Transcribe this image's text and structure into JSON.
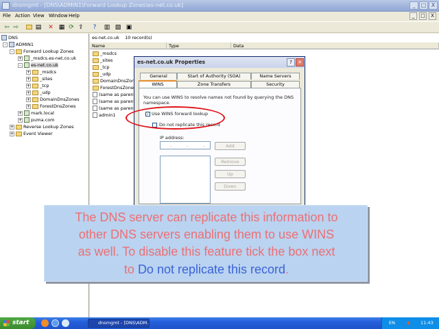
{
  "window": {
    "title": "dnsmgmt - [DNS\\ADMIN1\\Forward Lookup Zones\\es-net.co.uk]",
    "buttons": [
      "_",
      "□",
      "X"
    ]
  },
  "menubar": {
    "items": [
      "File",
      "Action",
      "View",
      "Window",
      "Help"
    ],
    "child_buttons": [
      "_",
      "□",
      "X"
    ]
  },
  "toolbar": {
    "icons": [
      "back-icon",
      "forward-icon",
      "up-folder-icon",
      "show-hide-tree-icon",
      "delete-icon",
      "properties-icon",
      "refresh-icon",
      "export-icon",
      "help-icon",
      "server-icon",
      "zone-icon",
      "record-icon"
    ]
  },
  "tree": {
    "nodes": [
      {
        "label": "DNS",
        "icon": "dns-icon"
      },
      {
        "label": "ADMIN1",
        "icon": "server-icon",
        "pm": "-"
      },
      {
        "label": "Forward Lookup Zones",
        "icon": "folder-icon",
        "pm": "-"
      },
      {
        "label": "_msdcs.es-net.co.uk",
        "icon": "zone-icon",
        "pm": "+"
      },
      {
        "label": "es-net.co.uk",
        "icon": "zone-icon",
        "pm": "-"
      },
      {
        "label": "_msdcs",
        "icon": "folder-icon",
        "pm": "+"
      },
      {
        "label": "_sites",
        "icon": "folder-icon",
        "pm": "+"
      },
      {
        "label": "_tcp",
        "icon": "folder-icon",
        "pm": "+"
      },
      {
        "label": "_udp",
        "icon": "folder-icon",
        "pm": "+"
      },
      {
        "label": "DomainDnsZones",
        "icon": "folder-icon",
        "pm": "+"
      },
      {
        "label": "ForestDnsZones",
        "icon": "folder-icon",
        "pm": "+"
      },
      {
        "label": "mark.local",
        "icon": "zone-icon",
        "pm": "+"
      },
      {
        "label": "puma.com",
        "icon": "zone-icon",
        "pm": "+"
      },
      {
        "label": "Reverse Lookup Zones",
        "icon": "folder-icon",
        "pm": "+"
      },
      {
        "label": "Event Viewer",
        "icon": "folder-icon",
        "pm": "+"
      }
    ]
  },
  "content": {
    "crumb_zone": "es-net.co.uk",
    "crumb_count": "10 record(s)",
    "columns": [
      "Name",
      "Type",
      "Data"
    ],
    "records": [
      "_msdcs",
      "_sites",
      "_tcp",
      "_udp",
      "DomainDnsZones",
      "ForestDnsZones",
      "(same as parent",
      "(same as parent",
      "(same as parent",
      "admin1"
    ]
  },
  "dialog": {
    "title": "es-net.co.uk Properties",
    "tabs_row1": [
      "General",
      "Start of Authority (SOA)",
      "Name Servers"
    ],
    "tabs_row2": [
      "WINS",
      "Zone Transfers",
      "Security"
    ],
    "description_line1": "You can use WINS to resolve names not found by querying the DNS",
    "description_line2": "namespace.",
    "use_wins_label": "Use WINS forward lookup",
    "use_wins_checked": true,
    "no_replicate_label": "Do not replicate this record",
    "no_replicate_checked": false,
    "ip_label": "IP address:",
    "ip_value": ". . .",
    "buttons": {
      "add": "Add",
      "remove": "Remove",
      "up": "Up",
      "down": "Down"
    }
  },
  "caption": {
    "line1": "The DNS server can replicate this information to",
    "line2": "other DNS servers enabling them to use WINS",
    "line3": "as well. To disable this feature tick the box next",
    "line4_pre": "to ",
    "line4_highlight": "Do not replicate this record",
    "line4_post": ".",
    "text_color": "#ec6f74",
    "highlight_color": "#3b63d9",
    "background": "#bad3f0"
  },
  "taskbar": {
    "start": "start",
    "task": "dnsmgmt - [DNS\\ADM...",
    "lang": "EN",
    "clock": "11:43"
  }
}
